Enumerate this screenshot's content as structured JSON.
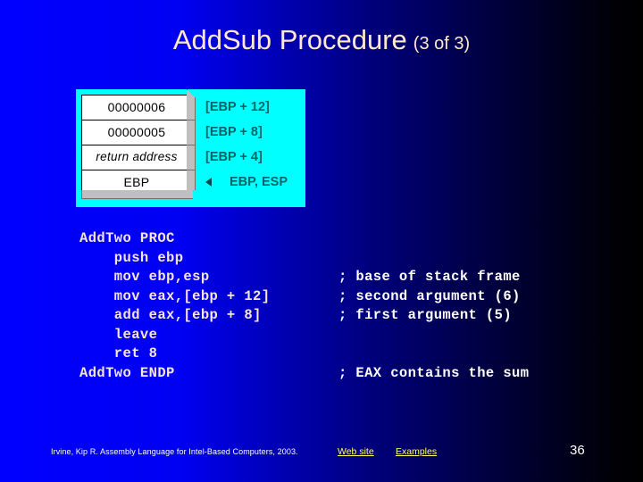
{
  "title": {
    "main": "AddSub Procedure",
    "sub": "(3 of 3)"
  },
  "diagram": {
    "stack_cells": [
      {
        "text": "00000006",
        "style": "normal"
      },
      {
        "text": "00000005",
        "style": "normal"
      },
      {
        "text": "return address",
        "style": "italic"
      },
      {
        "text": "EBP",
        "style": "normal"
      }
    ],
    "offset_labels": [
      "[EBP + 12]",
      "[EBP + 8]",
      "[EBP + 4]"
    ],
    "register_label": "EBP, ESP",
    "arrow_icon": "left-triangle-icon",
    "panel_color": "#00FFFF",
    "label_color": "#006666"
  },
  "code": {
    "lines": [
      {
        "text": "AddTwo PROC",
        "comment": ""
      },
      {
        "text": "    push ebp",
        "comment": ""
      },
      {
        "text": "    mov ebp,esp",
        "comment": "; base of stack frame"
      },
      {
        "text": "    mov eax,[ebp + 12]",
        "comment": "; second argument (6)"
      },
      {
        "text": "    add eax,[ebp + 8]",
        "comment": "; first argument (5)"
      },
      {
        "text": "    leave",
        "comment": ""
      },
      {
        "text": "    ret 8",
        "comment": ""
      },
      {
        "text": "AddTwo ENDP",
        "comment": "; EAX contains the sum"
      }
    ]
  },
  "footer": {
    "citation": "Irvine, Kip R. Assembly Language for Intel-Based Computers, 2003.",
    "link_web": "Web site",
    "link_examples": "Examples",
    "page_number": "36"
  },
  "colors": {
    "background_start": "#0000FF",
    "background_end": "#000000",
    "title": "#FFE8CC",
    "code": "#F7E6D8",
    "comment": "#FFFFFF",
    "link": "#FFFF66"
  }
}
